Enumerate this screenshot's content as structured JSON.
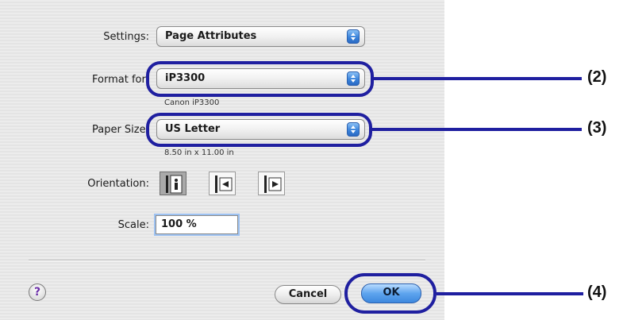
{
  "settings": {
    "label": "Settings:",
    "value": "Page Attributes"
  },
  "format_for": {
    "label": "Format for:",
    "value": "iP3300",
    "subtext": "Canon iP3300"
  },
  "paper_size": {
    "label": "Paper Size:",
    "value": "US Letter",
    "subtext": "8.50 in x 11.00 in"
  },
  "orientation": {
    "label": "Orientation:",
    "options": [
      "portrait",
      "landscape-left",
      "landscape-right"
    ],
    "selected": "portrait"
  },
  "scale": {
    "label": "Scale:",
    "value": "100 %"
  },
  "help": {
    "glyph": "?"
  },
  "buttons": {
    "cancel": "Cancel",
    "ok": "OK"
  },
  "callouts": [
    "(2)",
    "(3)",
    "(4)"
  ],
  "colors": {
    "callout": "#1f1fa0",
    "accent": "#3b84db"
  }
}
